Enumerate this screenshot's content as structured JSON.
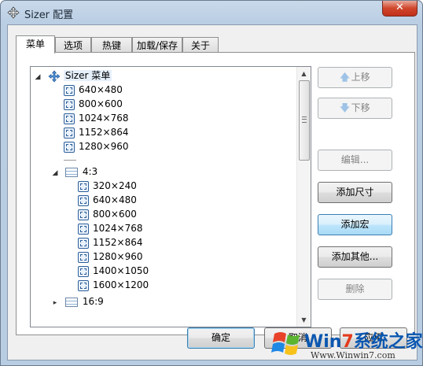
{
  "window": {
    "title": "Sizer 配置",
    "close_label": "✕"
  },
  "tabs": [
    {
      "label": "菜单"
    },
    {
      "label": "选项"
    },
    {
      "label": "热键"
    },
    {
      "label": "加载/保存"
    },
    {
      "label": "关于"
    }
  ],
  "tree": {
    "root": {
      "label": "Sizer 菜单",
      "expander": "◢"
    },
    "top_items": [
      "640×480",
      "800×600",
      "1024×768",
      "1152×864",
      "1280×960"
    ],
    "group_43": {
      "label": "4:3",
      "expander": "◢"
    },
    "group_43_items": [
      "320×240",
      "640×480",
      "800×600",
      "1024×768",
      "1152×864",
      "1280×960",
      "1400×1050",
      "1600×1200"
    ],
    "group_169": {
      "label": "16:9",
      "expander": "▸"
    }
  },
  "scrollbar": {
    "up_arrow": "▲",
    "down_arrow": "▼"
  },
  "buttons": {
    "move_up": "上移",
    "move_down": "下移",
    "edit": "编辑...",
    "add_size": "添加尺寸",
    "add_macro": "添加宏",
    "add_other": "添加其他...",
    "delete": "删除",
    "ok": "确定",
    "cancel": "取消",
    "apply": "应用"
  },
  "watermark": {
    "brand_prefix": "Win",
    "brand_seven": "7",
    "brand_suffix": "系统之家",
    "url": "Www.Winwin7.com"
  }
}
